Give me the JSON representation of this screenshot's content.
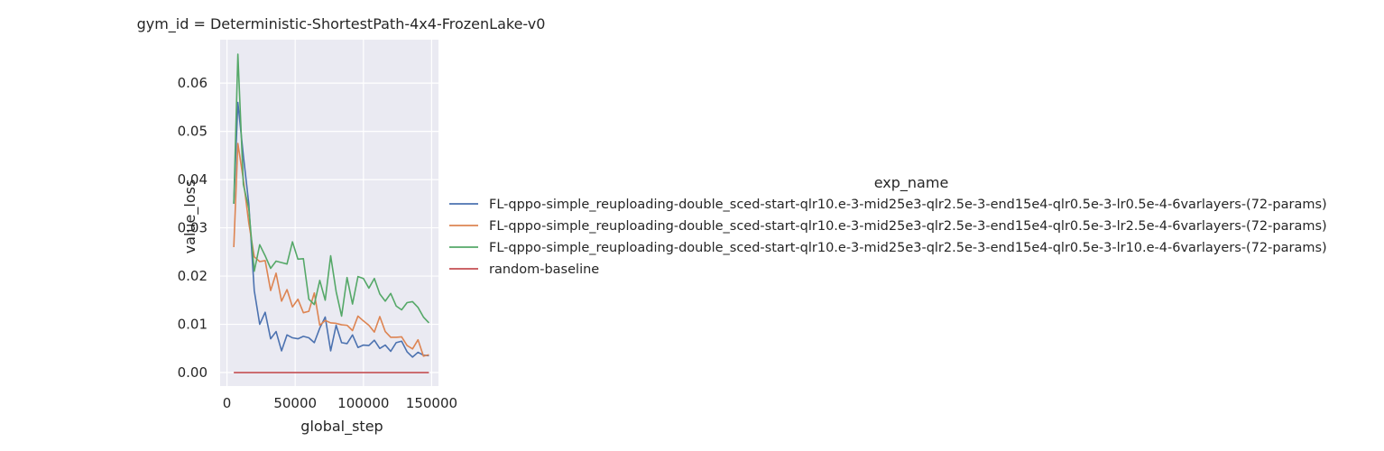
{
  "chart_data": {
    "type": "line",
    "title": "gym_id = Deterministic-ShortestPath-4x4-FrozenLake-v0",
    "xlabel": "global_step",
    "ylabel": "value_loss",
    "xlim": [
      -5000,
      155000
    ],
    "ylim": [
      -0.0028,
      0.069
    ],
    "xticks": [
      0,
      50000,
      100000,
      150000
    ],
    "xtick_labels": [
      "0",
      "50000",
      "100000",
      "150000"
    ],
    "yticks": [
      0.0,
      0.01,
      0.02,
      0.03,
      0.04,
      0.05,
      0.06
    ],
    "ytick_labels": [
      "0.00",
      "0.01",
      "0.02",
      "0.03",
      "0.04",
      "0.05",
      "0.06"
    ],
    "grid": true,
    "background": "#eaeaf2",
    "legend": {
      "title": "exp_name",
      "placement": "right"
    },
    "x": [
      5000,
      8000,
      12000,
      16000,
      20000,
      24000,
      28000,
      32000,
      36000,
      40000,
      44000,
      48000,
      52000,
      56000,
      60000,
      64000,
      68000,
      72000,
      76000,
      80000,
      84000,
      88000,
      92000,
      96000,
      100000,
      104000,
      108000,
      112000,
      116000,
      120000,
      124000,
      128000,
      132000,
      136000,
      140000,
      144000,
      148000
    ],
    "series": [
      {
        "name": "FL-qppo-simple_reuploading-double_sced-start-qlr10.e-3-mid25e3-qlr2.5e-3-end15e4-qlr0.5e-3-lr0.5e-4-6varlayers-(72-params)",
        "color": "#4c72b0",
        "values": [
          0.035,
          0.056,
          0.045,
          0.035,
          0.017,
          0.01,
          0.0125,
          0.007,
          0.0085,
          0.0045,
          0.0078,
          0.0072,
          0.007,
          0.0075,
          0.0072,
          0.0062,
          0.0092,
          0.0115,
          0.0045,
          0.0098,
          0.0062,
          0.006,
          0.0078,
          0.0052,
          0.0057,
          0.0056,
          0.0067,
          0.005,
          0.0057,
          0.0044,
          0.0062,
          0.0065,
          0.0043,
          0.0032,
          0.0042,
          0.0036,
          0.0035
        ]
      },
      {
        "name": "FL-qppo-simple_reuploading-double_sced-start-qlr10.e-3-mid25e3-qlr2.5e-3-end15e4-qlr0.5e-3-lr2.5e-4-6varlayers-(72-params)",
        "color": "#dd8452",
        "values": [
          0.026,
          0.0475,
          0.04,
          0.031,
          0.024,
          0.023,
          0.0232,
          0.017,
          0.0206,
          0.0148,
          0.0172,
          0.0136,
          0.0152,
          0.0124,
          0.0127,
          0.0165,
          0.0098,
          0.0108,
          0.0103,
          0.0102,
          0.0099,
          0.0098,
          0.0087,
          0.0117,
          0.0107,
          0.0098,
          0.0084,
          0.0116,
          0.0085,
          0.0073,
          0.0073,
          0.0074,
          0.0056,
          0.0049,
          0.0068,
          0.0034,
          0.0037
        ]
      },
      {
        "name": "FL-qppo-simple_reuploading-double_sced-start-qlr10.e-3-mid25e3-qlr2.5e-3-end15e4-qlr0.5e-3-lr10.e-4-6varlayers-(72-params)",
        "color": "#55a868",
        "values": [
          0.035,
          0.066,
          0.039,
          0.034,
          0.021,
          0.0265,
          0.0242,
          0.0216,
          0.0231,
          0.0228,
          0.0225,
          0.0271,
          0.0235,
          0.0236,
          0.0152,
          0.0141,
          0.0191,
          0.015,
          0.0242,
          0.0168,
          0.0117,
          0.0197,
          0.0142,
          0.0199,
          0.0195,
          0.0175,
          0.0195,
          0.0163,
          0.0148,
          0.0164,
          0.0138,
          0.013,
          0.0145,
          0.0147,
          0.0135,
          0.0115,
          0.0103
        ]
      },
      {
        "name": "random-baseline",
        "color": "#c44e52",
        "values": [
          0,
          0,
          0,
          0,
          0,
          0,
          0,
          0,
          0,
          0,
          0,
          0,
          0,
          0,
          0,
          0,
          0,
          0,
          0,
          0,
          0,
          0,
          0,
          0,
          0,
          0,
          0,
          0,
          0,
          0,
          0,
          0,
          0,
          0,
          0,
          0,
          0
        ]
      }
    ]
  }
}
